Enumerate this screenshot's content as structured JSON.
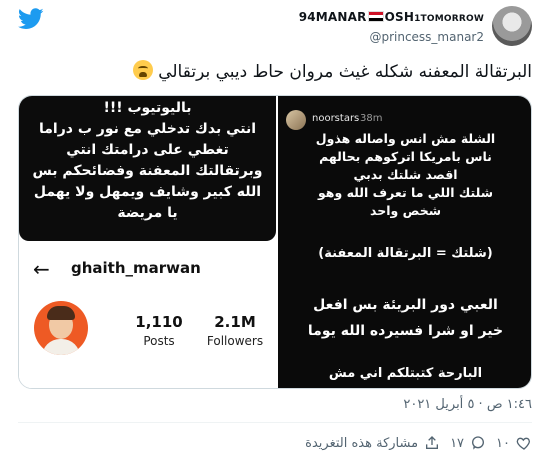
{
  "tweet": {
    "display_name_before": "94MANAR",
    "display_name_after": "OSH",
    "display_name_tail": "1TOMORROW",
    "handle": "@princess_manar2",
    "text": "البرتقالة المعفنه شكله غيث مروان حاط ديبي برتقالي",
    "timestamp": "١:٤٦ ص · ٥ أبريل ٢٠٢١"
  },
  "media_left": {
    "story_lines": [
      "باليوتيوب !!!",
      "انتي بدك تدخلي مع نور ب دراما",
      "تغطي على درامتك انتي",
      "وبرتقالتك المعفنة وفضائحكم بس",
      "الله كبير وشايف ويمهل ولا يهمل",
      "يا مريضة"
    ],
    "profile": {
      "back_glyph": "←",
      "username": "ghaith_marwan",
      "posts_value": "1,110",
      "posts_label": "Posts",
      "followers_value": "2.1M",
      "followers_label": "Followers"
    }
  },
  "media_right": {
    "ig_user": "noorstars",
    "ig_time": "38m",
    "lines_block1": [
      "الشلة مش انس واصاله هذول",
      "ناس بامريكا اتركوهم بحالهم",
      "اقصد شلتك بدبي",
      "شلتك اللي ما تعرف الله وهو",
      "شخص واحد"
    ],
    "line_equation": "(شلتك = البرتقالة المعفنة)",
    "lines_block3": [
      "العبي دور البريئة بس افعل",
      "خير او شرا فسيرده الله يوما"
    ],
    "line_cut": "البارحة كتبتلكم اني مش"
  },
  "actions": {
    "likes_count": "١٠",
    "retweets_count": "١٧",
    "share_label": "مشاركة هذه التغريدة"
  },
  "colors": {
    "brand_blue": "#1d9bf0",
    "secondary_text": "#536471",
    "avatar_orange": "#ee5a24"
  },
  "icons": [
    "twitter-bird-icon",
    "flag-icon",
    "crying-face-icon",
    "back-arrow-icon",
    "heart-icon",
    "retweet-icon",
    "share-icon"
  ]
}
